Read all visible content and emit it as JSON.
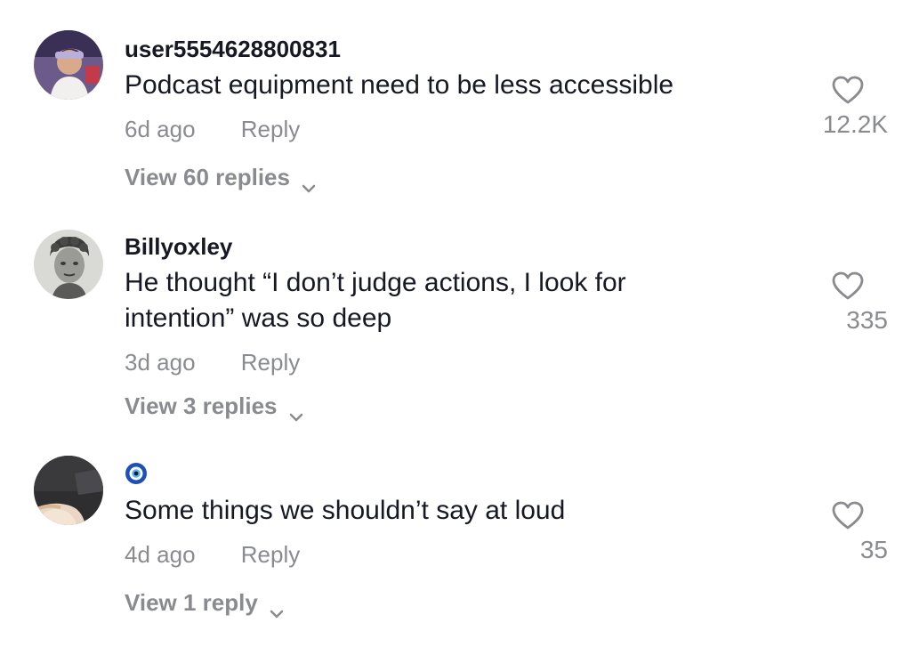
{
  "comments": [
    {
      "username": "user5554628800831",
      "text": "Podcast equipment need to be less accessible",
      "time": "6d ago",
      "reply_label": "Reply",
      "view_replies": "View 60 replies",
      "likes": "12.2K"
    },
    {
      "username": "Billyoxley",
      "text": "He thought “I don’t judge actions, I look for intention” was so deep",
      "time": "3d ago",
      "reply_label": "Reply",
      "view_replies": "View 3 replies",
      "likes": "335"
    },
    {
      "username_icon": "nazar-eye-emoji",
      "text": "Some things we shouldn’t say at loud",
      "time": "4d ago",
      "reply_label": "Reply",
      "view_replies": "View 1 reply",
      "likes": "35"
    }
  ],
  "colors": {
    "primary_text": "#161823",
    "secondary_text": "#8a8b91",
    "background": "#ffffff"
  }
}
